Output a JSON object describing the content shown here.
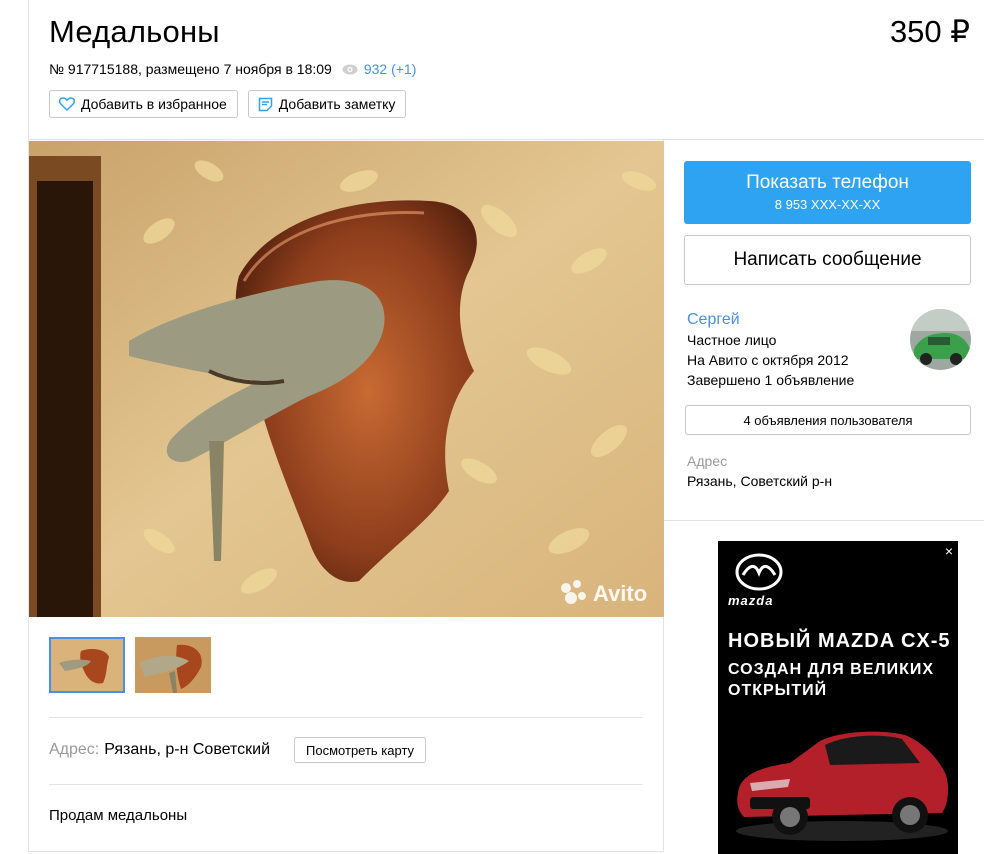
{
  "listing": {
    "title": "Медальоны",
    "price": "350 ₽",
    "meta": "№ 917715188, размещено 7 ноября в 18:09",
    "views": "932 (+1)",
    "favorite_label": "Добавить в избранное",
    "note_label": "Добавить заметку"
  },
  "gallery": {
    "watermark": "Avito"
  },
  "location": {
    "label": "Адрес:",
    "value": "Рязань, р-н Советский",
    "map_button": "Посмотреть карту"
  },
  "description": "Продам медальоны",
  "contact": {
    "phone_button": "Показать телефон",
    "phone_masked": "8 953 XXX-XX-XX",
    "message_button": "Написать сообщение"
  },
  "seller": {
    "name": "Сергей",
    "type": "Частное лицо",
    "since": "На Авито с октября 2012",
    "completed": "Завершено 1 объявление",
    "ads_button": "4 объявления пользователя",
    "address_label": "Адрес",
    "address": "Рязань, Советский р-н"
  },
  "ad": {
    "brand": "mazda",
    "headline": "НОВЫЙ MAZDA CX-5",
    "subline": "СОЗДАН ДЛЯ ВЕЛИКИХ ОТКРЫТИЙ",
    "close": "×"
  },
  "colors": {
    "accent": "#2ea3f2",
    "link": "#4a90e2"
  }
}
